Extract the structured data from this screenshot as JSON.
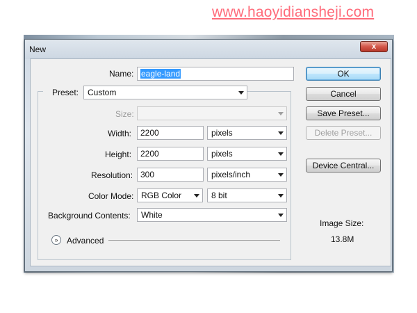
{
  "watermark": "www.haoyidiansheji.com",
  "window": {
    "title": "New",
    "close_label": "x"
  },
  "form": {
    "name_label": "Name:",
    "name_value": "eagle-land",
    "preset_label": "Preset:",
    "preset_value": "Custom",
    "size_label": "Size:",
    "size_value": "",
    "width_label": "Width:",
    "width_value": "2200",
    "width_unit": "pixels",
    "height_label": "Height:",
    "height_value": "2200",
    "height_unit": "pixels",
    "resolution_label": "Resolution:",
    "resolution_value": "300",
    "resolution_unit": "pixels/inch",
    "color_mode_label": "Color Mode:",
    "color_mode_value": "RGB Color",
    "bit_depth_value": "8 bit",
    "background_label": "Background Contents:",
    "background_value": "White",
    "advanced_label": "Advanced"
  },
  "buttons": {
    "ok": "OK",
    "cancel": "Cancel",
    "save_preset": "Save Preset...",
    "delete_preset": "Delete Preset...",
    "device_central": "Device Central..."
  },
  "image_size": {
    "label": "Image Size:",
    "value": "13.8M"
  },
  "icons": {
    "close": "close-icon",
    "advanced": "chevron-double-down-icon",
    "dropdown": "chevron-down-icon"
  },
  "colors": {
    "selection": "#3399ff",
    "watermark": "#ff6b7a",
    "close_button": "#d3574a"
  }
}
